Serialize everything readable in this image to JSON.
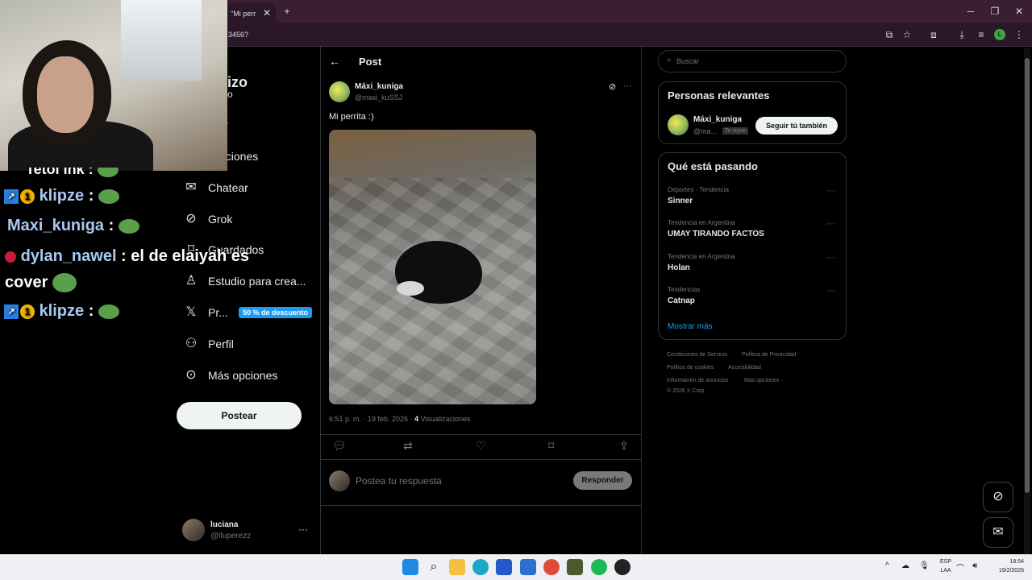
{
  "browser": {
    "tab_title": "\"Mi perr",
    "url_fragment": "3456?",
    "profile_initial": "L"
  },
  "chat": [
    {
      "user": "",
      "text": "Tetol ink :",
      "partial": true
    },
    {
      "user": "klipze",
      "sep": " :",
      "text": ""
    },
    {
      "user": "Maxi_kuniga",
      "sep": " :",
      "text": ""
    },
    {
      "user": "dylan_nawel",
      "sep": " :",
      "text": " el de elaiyah es"
    },
    {
      "user": "",
      "text": "cover"
    },
    {
      "user": "klipze",
      "sep": " :",
      "text": ""
    }
  ],
  "nav": {
    "brand_partial": "izo",
    "brand_sub": "o",
    "items": [
      {
        "label": "orar",
        "icon": "compass-icon"
      },
      {
        "label": "ficaciones",
        "icon": "bell-icon"
      },
      {
        "label": "Chatear",
        "icon": "mail-icon"
      },
      {
        "label": "Grok",
        "icon": "grok-icon"
      },
      {
        "label": "Guardados",
        "icon": "bookmark-icon"
      },
      {
        "label": "Estudio para crea...",
        "icon": "studio-icon"
      },
      {
        "label": "Pr...",
        "icon": "x-logo-icon"
      },
      {
        "label": "Perfil",
        "icon": "person-icon"
      },
      {
        "label": "Más opciones",
        "icon": "more-circle-icon"
      }
    ],
    "promo": "50 % de descuento",
    "post_button": "Postear",
    "account": {
      "name": "luciana",
      "handle": "@lluperezz"
    }
  },
  "post": {
    "header": "Post",
    "author_name": "Máxi_kuniga",
    "author_handle": "@maxi_kuSSJ",
    "text": "Mi perrita :)",
    "time": "6:51 p. m. · 19 feb. 2026 ·",
    "views_count": "4",
    "views_label": "Visualizaciones",
    "reply_placeholder": "Postea tu respuesta",
    "reply_button": "Responder"
  },
  "sidebar": {
    "search_placeholder": "Buscar",
    "relevant_title": "Personas relevantes",
    "relevant_user": {
      "name": "Máxi_kuniga",
      "handle": "@ma...",
      "follows_you": "Te sigue",
      "follow_button": "Seguir tú también"
    },
    "trends_title": "Qué está pasando",
    "trends": [
      {
        "meta": "Deportes · Tendencia",
        "name": "Sinner"
      },
      {
        "meta": "Tendencia en Argentina",
        "name": "UMAY TIRANDO FACTOS"
      },
      {
        "meta": "Tendencia en Argentina",
        "name": "Holan"
      },
      {
        "meta": "Tendencias",
        "name": "Catnap"
      }
    ],
    "show_more": "Mostrar más",
    "footer": {
      "terms": "Condiciones de Servicio",
      "privacy": "Política de Privacidad",
      "cookies": "Política de cookies",
      "accessibility": "Accesibilidad",
      "ads": "Información de anuncios",
      "more": "Más opciones ···",
      "copyright": "© 2026 X Corp."
    }
  },
  "taskbar": {
    "lang_top": "ESP",
    "lang_bottom": "LAA",
    "time": "18:54",
    "date": "19/2/2026"
  }
}
